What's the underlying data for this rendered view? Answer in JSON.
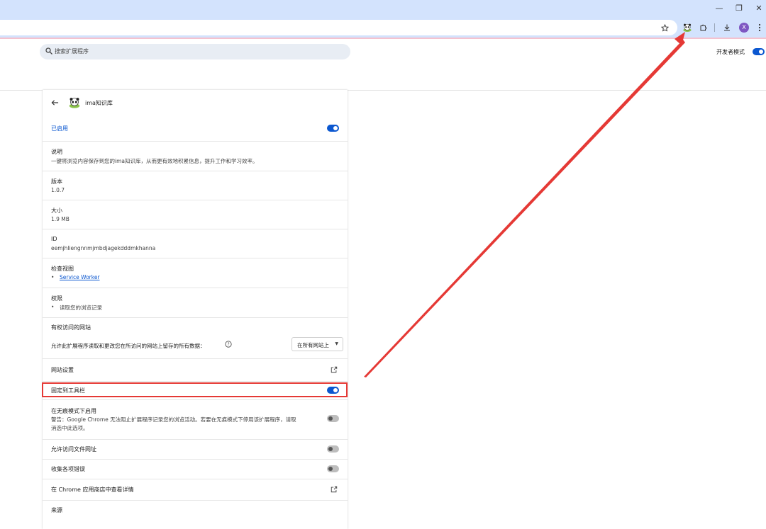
{
  "window": {
    "minimize": "—",
    "restore": "❐",
    "close": "✕"
  },
  "toolbar": {
    "avatar_initial": "X"
  },
  "icons": [
    "bookmark-star-icon",
    "panda-extension-icon",
    "extensions-puzzle-icon",
    "download-icon",
    "avatar",
    "more-menu-icon"
  ],
  "header": {
    "search_placeholder": "搜索扩展程序",
    "dev_mode_label": "开发者模式",
    "dev_mode_on": true
  },
  "extension": {
    "name": "ima知识库",
    "enabled_label": "已启用",
    "enabled": true,
    "description_label": "说明",
    "description": "一键将浏览内容保存到您的ima知识库，从而更有效地积累信息，提升工作和学习效率。",
    "version_label": "版本",
    "version": "1.0.7",
    "size_label": "大小",
    "size": "1.9 MB",
    "id_label": "ID",
    "id": "eemjhliengnnmjmbdjagekdddmkhanna",
    "inspect_label": "检查视图",
    "inspect_link": "Service Worker",
    "permissions_label": "权限",
    "permission_item": "读取您的浏览记录",
    "site_access_label": "有权访问的网站",
    "site_access_desc": "允许此扩展程序读取和更改您在所访问的网站上留存的所有数据：",
    "site_access_value": "在所有网站上",
    "site_settings_label": "网站设置",
    "pin_label": "固定到工具栏",
    "pin_on": true,
    "incognito_label": "在无痕模式下启用",
    "incognito_warning_1": "警告：Google Chrome 无法阻止扩展程序记录您的浏览活动。若要在无痕模式下停用该扩展程序，请取",
    "incognito_warning_2": "消选中此选项。",
    "incognito_on": false,
    "file_access_label": "允许访问文件网址",
    "file_access_on": false,
    "errors_label": "收集各项错误",
    "errors_on": false,
    "webstore_label": "在 Chrome 应用商店中查看详情",
    "source_label": "来源"
  },
  "colors": {
    "accent": "#0b57d0",
    "frame": "#d3e3fd",
    "annotation": "#e53935"
  }
}
